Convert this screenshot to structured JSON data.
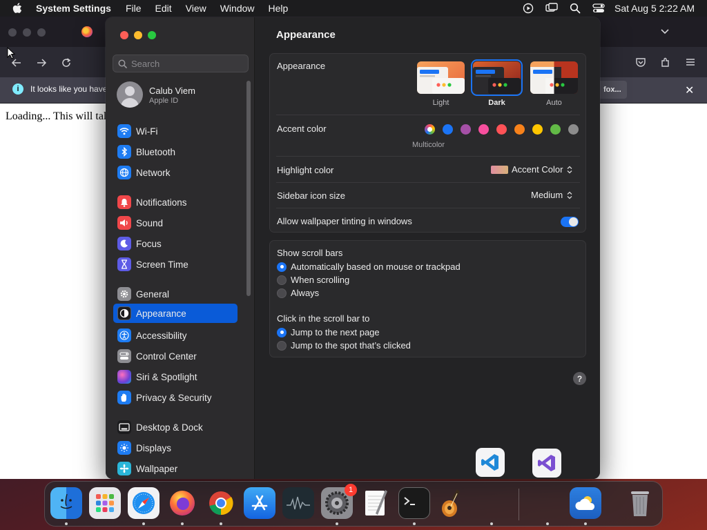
{
  "menubar": {
    "app_name": "System Settings",
    "menus": [
      "File",
      "Edit",
      "View",
      "Window",
      "Help"
    ],
    "clock": "Sat Aug 5  2:22 AM"
  },
  "browser": {
    "info_text": "It looks like you have",
    "info_button": "fox...",
    "page_text": "Loading... This will tal"
  },
  "sidebar": {
    "search_placeholder": "Search",
    "profile": {
      "name": "Calub Viem",
      "subtitle": "Apple ID"
    },
    "items": [
      {
        "label": "Wi-Fi",
        "icon": "wifi-icon",
        "color": "#1e7cf2"
      },
      {
        "label": "Bluetooth",
        "icon": "bluetooth-icon",
        "color": "#1e7cf2"
      },
      {
        "label": "Network",
        "icon": "network-icon",
        "color": "#1e7cf2"
      },
      {
        "label": "Notifications",
        "icon": "notifications-icon",
        "color": "#f0474a"
      },
      {
        "label": "Sound",
        "icon": "sound-icon",
        "color": "#f0474a"
      },
      {
        "label": "Focus",
        "icon": "focus-icon",
        "color": "#5e5ce6"
      },
      {
        "label": "Screen Time",
        "icon": "screen-time-icon",
        "color": "#5e5ce6"
      },
      {
        "label": "General",
        "icon": "gear-icon",
        "color": "#8e8e93"
      },
      {
        "label": "Appearance",
        "icon": "appearance-icon",
        "color": "#1c1c1e"
      },
      {
        "label": "Accessibility",
        "icon": "accessibility-icon",
        "color": "#1e7cf2"
      },
      {
        "label": "Control Center",
        "icon": "control-center-icon",
        "color": "#8e8e93"
      },
      {
        "label": "Siri & Spotlight",
        "icon": "siri-icon",
        "color": "#6b3fd6"
      },
      {
        "label": "Privacy & Security",
        "icon": "hand-icon",
        "color": "#1e7cf2"
      },
      {
        "label": "Desktop & Dock",
        "icon": "desktop-dock-icon",
        "color": "#1c1c1e"
      },
      {
        "label": "Displays",
        "icon": "displays-icon",
        "color": "#1e7cf2"
      },
      {
        "label": "Wallpaper",
        "icon": "wallpaper-icon",
        "color": "#2ab6d9"
      }
    ],
    "selected": "Appearance"
  },
  "content": {
    "title": "Appearance",
    "appearance": {
      "label": "Appearance",
      "options": [
        "Light",
        "Dark",
        "Auto"
      ],
      "selected": "Dark"
    },
    "accent": {
      "label": "Accent color",
      "caption": "Multicolor",
      "colors": [
        "multicolor",
        "#1b74f5",
        "#a550a7",
        "#f74f9e",
        "#ff5257",
        "#f7821b",
        "#ffc600",
        "#62ba46",
        "#8c8c8c"
      ]
    },
    "highlight": {
      "label": "Highlight color",
      "value": "Accent Color"
    },
    "sidebar_icon_size": {
      "label": "Sidebar icon size",
      "value": "Medium"
    },
    "wallpaper_tinting": {
      "label": "Allow wallpaper tinting in windows",
      "on": true
    },
    "scroll_bars": {
      "label": "Show scroll bars",
      "options": [
        "Automatically based on mouse or trackpad",
        "When scrolling",
        "Always"
      ],
      "selected": 0
    },
    "click_scroll": {
      "label": "Click in the scroll bar to",
      "options": [
        "Jump to the next page",
        "Jump to the spot that’s clicked"
      ],
      "selected": 0
    },
    "help": "?"
  },
  "dock": {
    "apps": [
      "Finder",
      "Launchpad",
      "Safari",
      "Firefox",
      "Chrome",
      "App Store",
      "Activity Monitor",
      "System Settings",
      "TextEdit",
      "Terminal",
      "GarageBand",
      "Weather",
      "Trash"
    ],
    "settings_badge": "1"
  }
}
